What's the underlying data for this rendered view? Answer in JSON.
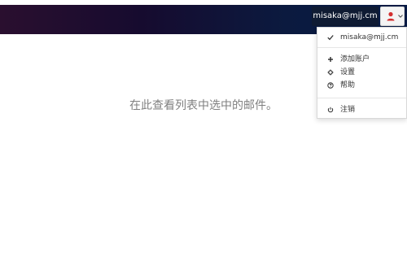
{
  "header": {
    "account_label": "misaka@mjj.cm"
  },
  "menu": {
    "current_account": "misaka@mjj.cm",
    "add_account": "添加账户",
    "settings": "设置",
    "help": "帮助",
    "logout": "注销"
  },
  "main": {
    "empty_message": "在此查看列表中选中的邮件。"
  },
  "colors": {
    "user_icon": "#d32f2f",
    "header_start": "#2a0f2f",
    "header_end": "#071a44"
  },
  "icons": {
    "user": "user-icon",
    "caret": "chevron-down-icon",
    "check": "check-icon",
    "plus": "plus-icon",
    "gear": "gear-icon",
    "help": "help-icon",
    "power": "power-icon"
  }
}
